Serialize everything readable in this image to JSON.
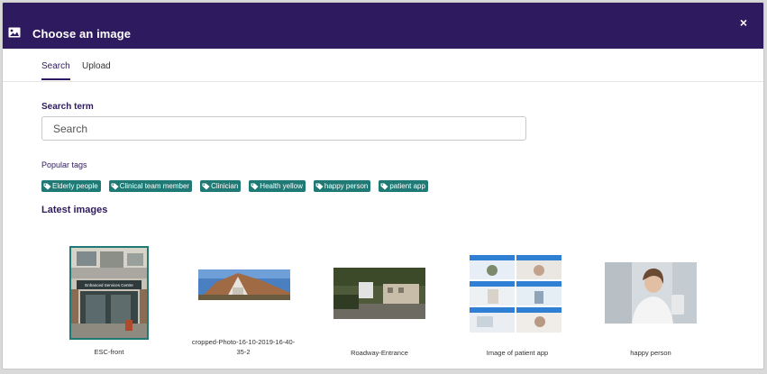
{
  "header": {
    "title": "Choose an image",
    "close_label": "×"
  },
  "tabs": [
    {
      "label": "Search",
      "active": true
    },
    {
      "label": "Upload",
      "active": false
    }
  ],
  "search": {
    "label": "Search term",
    "placeholder": "Search",
    "value": ""
  },
  "tags": {
    "label": "Popular tags",
    "items": [
      "Elderly people",
      "Clinical team member",
      "Clinician",
      "Health yellow",
      "happy person",
      "patient app"
    ]
  },
  "latest": {
    "label": "Latest images",
    "images": [
      {
        "caption": "ESC-front",
        "sign": "Enhanced Services Centre"
      },
      {
        "caption": "cropped-Photo-16-10-2019-16-40-35-2"
      },
      {
        "caption": "Roadway-Entrance"
      },
      {
        "caption": "Image of patient app"
      },
      {
        "caption": "happy person"
      }
    ]
  },
  "colors": {
    "header": "#2e1a5e",
    "tag": "#1f7a75",
    "accent": "#2e1a5e"
  }
}
